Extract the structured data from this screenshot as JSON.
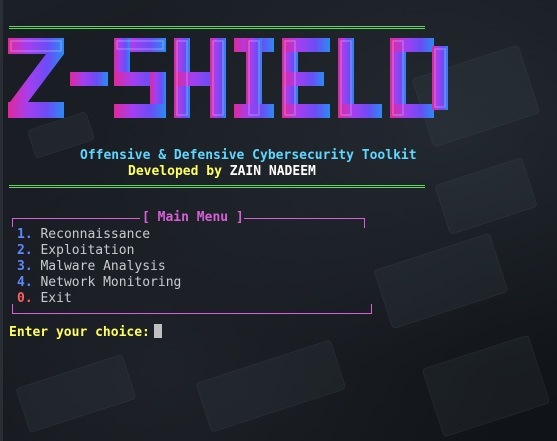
{
  "logo": {
    "text": "Z-SHIELD",
    "gradient": [
      "#e0289b",
      "#a43ff0",
      "#6a4df6",
      "#2b8cf2"
    ]
  },
  "subtitle": "Offensive & Defensive Cybersecurity Toolkit",
  "developer": {
    "prefix": "Developed by ",
    "name": "ZAIN NADEEM"
  },
  "menu": {
    "title": "[ Main Menu ]",
    "items": [
      {
        "number": "1.",
        "label": "Reconnaissance"
      },
      {
        "number": "2.",
        "label": "Exploitation"
      },
      {
        "number": "3.",
        "label": "Malware Analysis"
      },
      {
        "number": "4.",
        "label": "Network Monitoring"
      },
      {
        "number": "0.",
        "label": "Exit"
      }
    ]
  },
  "prompt": "Enter your choice:",
  "colors": {
    "rule": "#5fd75f",
    "subtitle": "#5fd7ff",
    "developer": "#ffff5f",
    "menu_border": "#d75fd7",
    "number_blue": "#5f87ff",
    "number_red": "#ff5f5f",
    "prompt": "#ffff5f"
  }
}
